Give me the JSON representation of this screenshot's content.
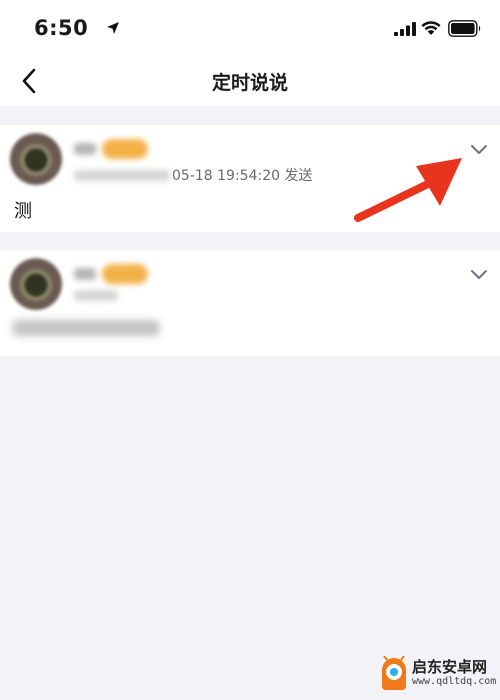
{
  "status_bar": {
    "time": "6:50",
    "icons": [
      "location-arrow-icon",
      "signal-icon",
      "wifi-icon",
      "battery-icon"
    ]
  },
  "nav": {
    "title": "定时说说",
    "back_icon": "chevron-left-icon"
  },
  "posts": [
    {
      "meta_suffix": "05-18 19:54:20 发送",
      "content": "测",
      "menu_icon": "chevron-down-icon"
    },
    {
      "meta_suffix": "",
      "content": "",
      "menu_icon": "chevron-down-icon"
    }
  ],
  "watermark": {
    "title": "启东安卓网",
    "url": "www.qdltdq.com"
  },
  "colors": {
    "background": "#f2f2f7",
    "card": "#ffffff",
    "annotation_arrow": "#e8341f",
    "chevron": "#6e6e8a"
  }
}
